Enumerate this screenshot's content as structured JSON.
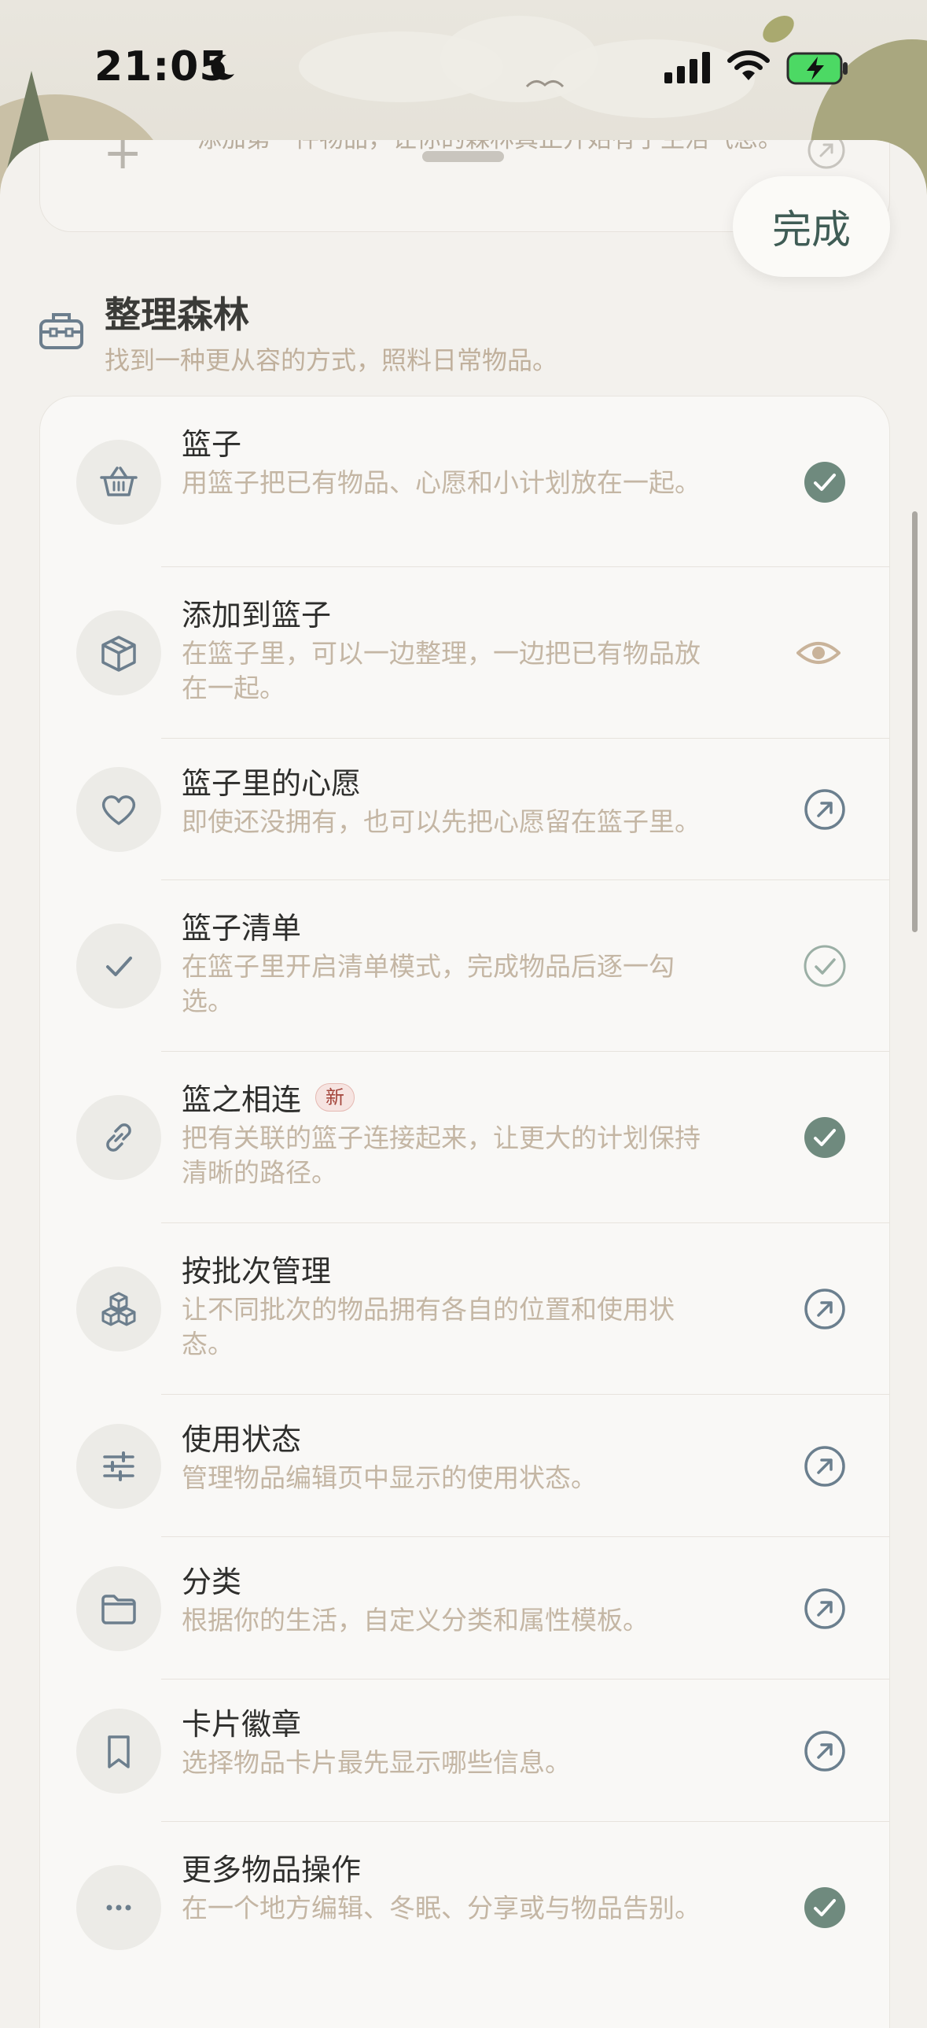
{
  "status_bar": {
    "time": "21:05"
  },
  "previous_item": {
    "text": "添加第一件物品，让你的森林真正开始有了生活气息。"
  },
  "done_button": {
    "label": "完成"
  },
  "section": {
    "title": "整理森林",
    "subtitle": "找到一种更从容的方式，照料日常物品。"
  },
  "items": [
    {
      "title": "篮子",
      "desc": "用篮子把已有物品、心愿和小计划放在一起。",
      "icon": "basket-icon",
      "status": "check-filled"
    },
    {
      "title": "添加到篮子",
      "desc": "在篮子里，可以一边整理，一边把已有物品放在一起。",
      "icon": "box-icon",
      "status": "eye"
    },
    {
      "title": "篮子里的心愿",
      "desc": "即使还没拥有，也可以先把心愿留在篮子里。",
      "icon": "heart-icon",
      "status": "arrow"
    },
    {
      "title": "篮子清单",
      "desc": "在篮子里开启清单模式，完成物品后逐一勾选。",
      "icon": "checkmark-icon",
      "status": "check-outline"
    },
    {
      "title": "篮之相连",
      "badge": "新",
      "desc": "把有关联的篮子连接起来，让更大的计划保持清晰的路径。",
      "icon": "link-icon",
      "status": "check-filled"
    },
    {
      "title": "按批次管理",
      "desc": "让不同批次的物品拥有各自的位置和使用状态。",
      "icon": "stacked-boxes-icon",
      "status": "arrow"
    },
    {
      "title": "使用状态",
      "desc": "管理物品编辑页中显示的使用状态。",
      "icon": "sliders-icon",
      "status": "arrow"
    },
    {
      "title": "分类",
      "desc": "根据你的生活，自定义分类和属性模板。",
      "icon": "folder-icon",
      "status": "arrow"
    },
    {
      "title": "卡片徽章",
      "desc": "选择物品卡片最先显示哪些信息。",
      "icon": "bookmark-icon",
      "status": "arrow"
    },
    {
      "title": "更多物品操作",
      "desc": "在一个地方编辑、冬眠、分享或与物品告别。",
      "icon": "more-dots-icon",
      "status": "check-filled"
    }
  ],
  "colors": {
    "accent": "#6f8a7e",
    "arrow": "#6b7f8e",
    "eye": "#c9b39a",
    "desc": "#c4b6a4"
  }
}
